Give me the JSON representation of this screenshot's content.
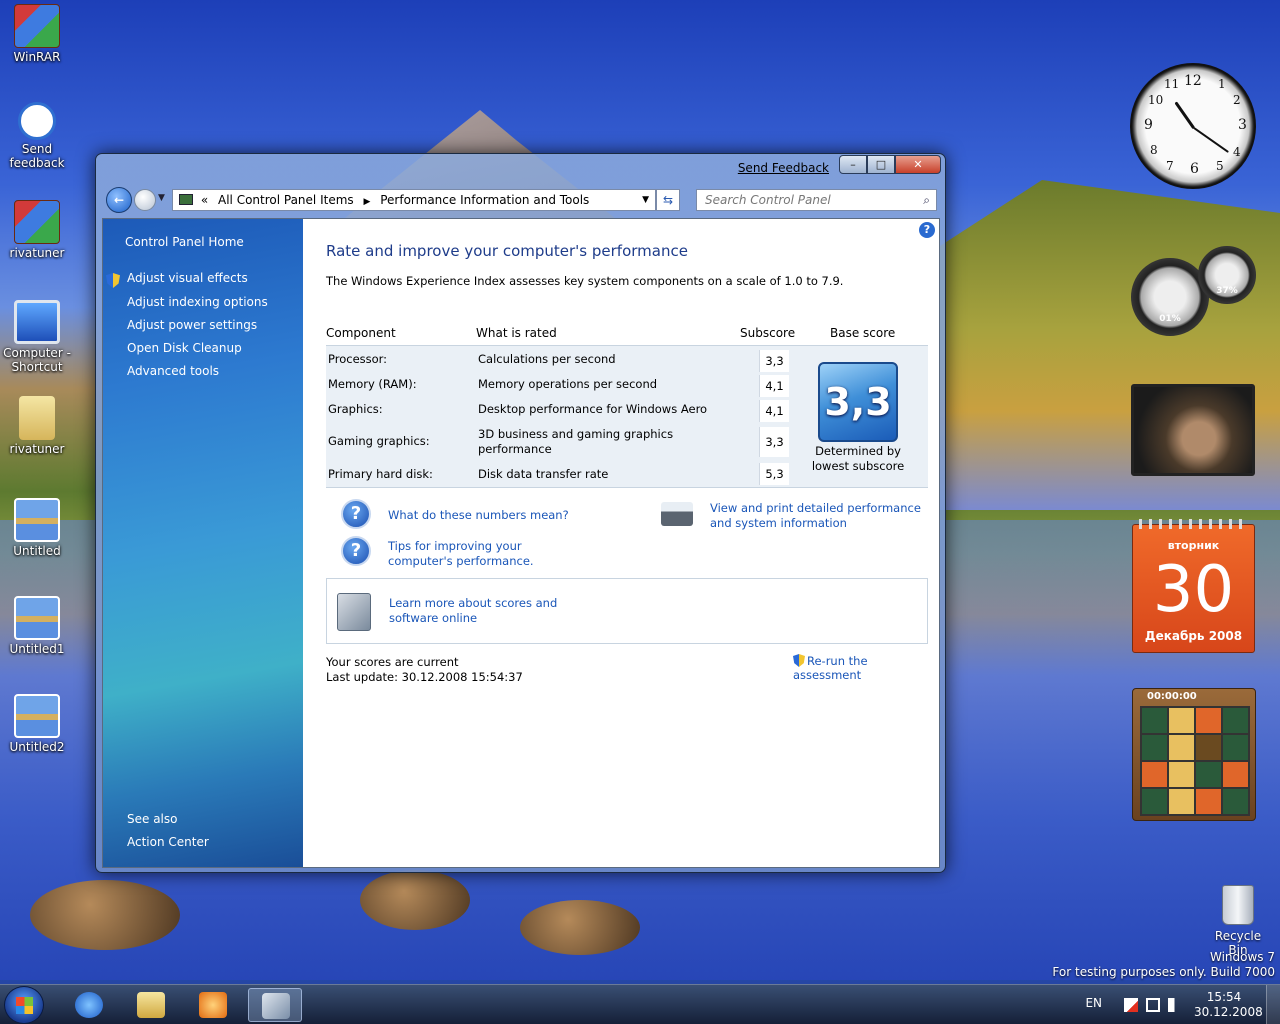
{
  "desktop": {
    "icons": [
      {
        "label": "WinRAR"
      },
      {
        "label": "Send feedback"
      },
      {
        "label": "rivatuner"
      },
      {
        "label": "Computer - Shortcut"
      },
      {
        "label": "rivatuner"
      },
      {
        "label": "Untitled"
      },
      {
        "label": "Untitled1"
      },
      {
        "label": "Untitled2"
      }
    ],
    "recycle_bin": "Recycle Bin",
    "watermark_line1": "Windows 7",
    "watermark_line2": "For testing purposes only. Build 7000"
  },
  "window": {
    "send_feedback": "Send Feedback",
    "minimize": "–",
    "maximize": "□",
    "close": "✕",
    "breadcrumb": {
      "prefix": "«",
      "item1": "All Control Panel Items",
      "item2": "Performance Information and Tools"
    },
    "search_placeholder": "Search Control Panel"
  },
  "sidebar": {
    "home": "Control Panel Home",
    "items": [
      {
        "label": "Adjust visual effects"
      },
      {
        "label": "Adjust indexing options"
      },
      {
        "label": "Adjust power settings"
      },
      {
        "label": "Open Disk Cleanup"
      },
      {
        "label": "Advanced tools"
      }
    ],
    "see_also": "See also",
    "action_center": "Action Center"
  },
  "main": {
    "help": "?",
    "title": "Rate and improve your computer's performance",
    "intro": "The Windows Experience Index assesses key system components on a scale of 1.0 to 7.9.",
    "table": {
      "headers": {
        "component": "Component",
        "what": "What is rated",
        "subscore": "Subscore",
        "base": "Base score"
      },
      "rows": [
        {
          "component": "Processor:",
          "what": "Calculations per second",
          "subscore": "3,3"
        },
        {
          "component": "Memory (RAM):",
          "what": "Memory operations per second",
          "subscore": "4,1"
        },
        {
          "component": "Graphics:",
          "what": "Desktop performance for Windows Aero",
          "subscore": "4,1"
        },
        {
          "component": "Gaming graphics:",
          "what": "3D business and gaming graphics performance",
          "subscore": "3,3"
        },
        {
          "component": "Primary hard disk:",
          "what": "Disk data transfer rate",
          "subscore": "5,3"
        }
      ],
      "base_score": "3,3",
      "base_caption": "Determined by lowest subscore"
    },
    "links": {
      "numbers": "What do these numbers mean?",
      "tips": "Tips for improving your computer's performance.",
      "print": "View and print detailed performance and system information",
      "learn": "Learn more about scores and software online"
    },
    "status_line1": "Your scores are current",
    "status_line2": "Last update: 30.12.2008 15:54:37",
    "rerun": "Re-run the assessment"
  },
  "gadgets": {
    "cpu_meter_left": "01%",
    "cpu_meter_right": "37%",
    "calendar_dow": "вторник",
    "calendar_day": "30",
    "calendar_month": "Декабрь 2008",
    "puzzle_timer": "00:00:00"
  },
  "taskbar": {
    "lang": "EN",
    "time": "15:54",
    "date": "30.12.2008"
  }
}
